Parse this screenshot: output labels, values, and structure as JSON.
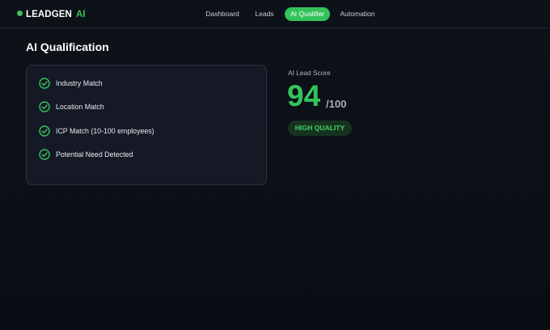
{
  "header": {
    "logo_text": "LEADGEN",
    "logo_accent": "AI",
    "nav": [
      {
        "label": "Dashboard",
        "active": false
      },
      {
        "label": "Leads",
        "active": false
      },
      {
        "label": "AI Qualifier",
        "active": true
      },
      {
        "label": "Automation",
        "active": false
      }
    ]
  },
  "page": {
    "title": "AI Qualification"
  },
  "checklist": {
    "items": [
      {
        "label": "Industry Match",
        "icon": "check-circle-icon"
      },
      {
        "label": "Location Match",
        "icon": "check-circle-icon"
      },
      {
        "label": "ICP Match (10-100 employees)",
        "icon": "check-circle-icon"
      },
      {
        "label": "Potential Need Detected",
        "icon": "check-circle-icon"
      }
    ]
  },
  "score": {
    "label": "AI Lead Score",
    "value": "94",
    "max": "/100",
    "badge": "HIGH QUALITY"
  },
  "colors": {
    "accent": "#35c45a",
    "background": "#0d1118",
    "card": "#141925",
    "badge_bg": "#16331f"
  }
}
